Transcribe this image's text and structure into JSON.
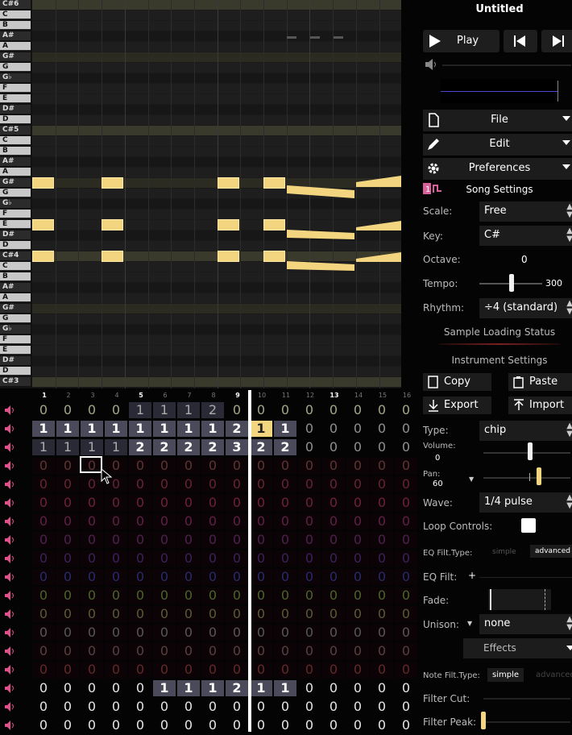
{
  "song": {
    "title": "Untitled"
  },
  "transport": {
    "play_label": "Play"
  },
  "menus": {
    "file": "File",
    "edit": "Edit",
    "preferences": "Preferences"
  },
  "song_settings": {
    "heading": "Song Settings",
    "scale_label": "Scale:",
    "scale_value": "Free",
    "key_label": "Key:",
    "key_value": "C#",
    "octave_label": "Octave:",
    "octave_value": "0",
    "tempo_label": "Tempo:",
    "tempo_value": "300",
    "rhythm_label": "Rhythm:",
    "rhythm_value": "÷4 (standard)",
    "sample_status": "Sample Loading Status"
  },
  "instrument": {
    "heading": "Instrument Settings",
    "copy": "Copy",
    "paste": "Paste",
    "export": "Export",
    "import": "Import",
    "type_label": "Type:",
    "type_value": "chip",
    "volume_label": "Volume:",
    "volume_value": "0",
    "pan_label": "Pan:",
    "pan_value": "60",
    "wave_label": "Wave:",
    "wave_value": "1/4 pulse",
    "loop_label": "Loop Controls:",
    "eq_type_label": "EQ Filt.Type:",
    "eq_simple": "simple",
    "eq_advanced": "advanced",
    "eq_filt_label": "EQ Filt:",
    "eq_add": "+",
    "fade_label": "Fade:",
    "unison_label": "Unison:",
    "unison_value": "none",
    "effects_label": "Effects",
    "note_type_label": "Note Filt.Type:",
    "note_simple": "simple",
    "note_advanced": "advanced",
    "filter_cut_label": "Filter Cut:",
    "filter_peak_label": "Filter Peak:"
  },
  "piano_keys": [
    {
      "label": "C#6",
      "black": true
    },
    {
      "label": "C",
      "black": false
    },
    {
      "label": "B",
      "black": false
    },
    {
      "label": "A#",
      "black": true
    },
    {
      "label": "A",
      "black": false
    },
    {
      "label": "G#",
      "black": true
    },
    {
      "label": "G",
      "black": false
    },
    {
      "label": "G♭",
      "black": true
    },
    {
      "label": "F",
      "black": false
    },
    {
      "label": "E",
      "black": false
    },
    {
      "label": "D#",
      "black": true
    },
    {
      "label": "D",
      "black": false
    },
    {
      "label": "C#5",
      "black": true
    },
    {
      "label": "C",
      "black": false
    },
    {
      "label": "B",
      "black": false
    },
    {
      "label": "A#",
      "black": true
    },
    {
      "label": "A",
      "black": false
    },
    {
      "label": "G#",
      "black": true
    },
    {
      "label": "G",
      "black": false
    },
    {
      "label": "G♭",
      "black": true
    },
    {
      "label": "F",
      "black": false
    },
    {
      "label": "E",
      "black": false
    },
    {
      "label": "D#",
      "black": true
    },
    {
      "label": "D",
      "black": false
    },
    {
      "label": "C#4",
      "black": true
    },
    {
      "label": "C",
      "black": false
    },
    {
      "label": "B",
      "black": false
    },
    {
      "label": "A#",
      "black": true
    },
    {
      "label": "A",
      "black": false
    },
    {
      "label": "G#",
      "black": true
    },
    {
      "label": "G",
      "black": false
    },
    {
      "label": "G♭",
      "black": true
    },
    {
      "label": "F",
      "black": false
    },
    {
      "label": "E",
      "black": false
    },
    {
      "label": "D#",
      "black": true
    },
    {
      "label": "D",
      "black": false
    },
    {
      "label": "C#3",
      "black": true
    }
  ],
  "columns": [
    "1",
    "2",
    "3",
    "4",
    "5",
    "6",
    "7",
    "8",
    "9",
    "10",
    "11",
    "12",
    "13",
    "14",
    "15",
    "16"
  ],
  "channels": [
    {
      "color": "#b8b89a",
      "cells": [
        "0",
        "0",
        "0",
        "0",
        "1",
        "1",
        "1",
        "2",
        "0",
        "0",
        "0",
        "0",
        "0",
        "0",
        "0",
        "0"
      ],
      "dim": [
        0,
        0,
        0,
        0,
        1,
        1,
        1,
        1,
        0,
        0,
        0,
        0,
        0,
        0,
        0,
        0
      ]
    },
    {
      "color": "#ffffff",
      "cells": [
        "1",
        "1",
        "1",
        "1",
        "1",
        "1",
        "1",
        "1",
        "2",
        "1",
        "1",
        "0",
        "0",
        "0",
        "0",
        "0"
      ],
      "dim": [
        2,
        2,
        2,
        2,
        2,
        2,
        2,
        2,
        2,
        3,
        2,
        0,
        0,
        0,
        0,
        0
      ]
    },
    {
      "color": "#ffffff",
      "cells": [
        "1",
        "1",
        "1",
        "1",
        "2",
        "2",
        "2",
        "2",
        "3",
        "2",
        "2",
        "0",
        "0",
        "0",
        "0",
        "0"
      ],
      "dim": [
        1,
        1,
        1,
        1,
        2,
        2,
        2,
        2,
        2,
        2,
        2,
        0,
        0,
        0,
        0,
        0
      ]
    },
    {
      "color": "#ab5a5a",
      "cells": [
        "0",
        "0",
        "0",
        "0",
        "0",
        "0",
        "0",
        "0",
        "0",
        "0",
        "0",
        "0",
        "0",
        "0",
        "0",
        "0"
      ],
      "dim": [
        0,
        0,
        0,
        0,
        0,
        0,
        0,
        0,
        0,
        0,
        0,
        0,
        0,
        0,
        0,
        0
      ]
    },
    {
      "color": "#b0405a",
      "cells": [
        "0",
        "0",
        "0",
        "0",
        "0",
        "0",
        "0",
        "0",
        "0",
        "0",
        "0",
        "0",
        "0",
        "0",
        "0",
        "0"
      ],
      "dim": [
        0,
        0,
        0,
        0,
        0,
        0,
        0,
        0,
        0,
        0,
        0,
        0,
        0,
        0,
        0,
        0
      ]
    },
    {
      "color": "#c03a6a",
      "cells": [
        "0",
        "0",
        "0",
        "0",
        "0",
        "0",
        "0",
        "0",
        "0",
        "0",
        "0",
        "0",
        "0",
        "0",
        "0",
        "0"
      ],
      "dim": [
        0,
        0,
        0,
        0,
        0,
        0,
        0,
        0,
        0,
        0,
        0,
        0,
        0,
        0,
        0,
        0
      ]
    },
    {
      "color": "#a83a7a",
      "cells": [
        "0",
        "0",
        "0",
        "0",
        "0",
        "0",
        "0",
        "0",
        "0",
        "0",
        "0",
        "0",
        "0",
        "0",
        "0",
        "0"
      ],
      "dim": [
        0,
        0,
        0,
        0,
        0,
        0,
        0,
        0,
        0,
        0,
        0,
        0,
        0,
        0,
        0,
        0
      ]
    },
    {
      "color": "#8a3a8a",
      "cells": [
        "0",
        "0",
        "0",
        "0",
        "0",
        "0",
        "0",
        "0",
        "0",
        "0",
        "0",
        "0",
        "0",
        "0",
        "0",
        "0"
      ],
      "dim": [
        0,
        0,
        0,
        0,
        0,
        0,
        0,
        0,
        0,
        0,
        0,
        0,
        0,
        0,
        0,
        0
      ]
    },
    {
      "color": "#6a3aa0",
      "cells": [
        "0",
        "0",
        "0",
        "0",
        "0",
        "0",
        "0",
        "0",
        "0",
        "0",
        "0",
        "0",
        "0",
        "0",
        "0",
        "0"
      ],
      "dim": [
        0,
        0,
        0,
        0,
        0,
        0,
        0,
        0,
        0,
        0,
        0,
        0,
        0,
        0,
        0,
        0
      ]
    },
    {
      "color": "#4a48c0",
      "cells": [
        "0",
        "0",
        "0",
        "0",
        "0",
        "0",
        "0",
        "0",
        "0",
        "0",
        "0",
        "0",
        "0",
        "0",
        "0",
        "0"
      ],
      "dim": [
        0,
        0,
        0,
        0,
        0,
        0,
        0,
        0,
        0,
        0,
        0,
        0,
        0,
        0,
        0,
        0
      ]
    },
    {
      "color": "#8ab04a",
      "cells": [
        "0",
        "0",
        "0",
        "0",
        "0",
        "0",
        "0",
        "0",
        "0",
        "0",
        "0",
        "0",
        "0",
        "0",
        "0",
        "0"
      ],
      "dim": [
        0,
        0,
        0,
        0,
        0,
        0,
        0,
        0,
        0,
        0,
        0,
        0,
        0,
        0,
        0,
        0
      ]
    },
    {
      "color": "#a0a060",
      "cells": [
        "0",
        "0",
        "0",
        "0",
        "0",
        "0",
        "0",
        "0",
        "0",
        "0",
        "0",
        "0",
        "0",
        "0",
        "0",
        "0"
      ],
      "dim": [
        0,
        0,
        0,
        0,
        0,
        0,
        0,
        0,
        0,
        0,
        0,
        0,
        0,
        0,
        0,
        0
      ]
    },
    {
      "color": "#9a9a9a",
      "cells": [
        "0",
        "0",
        "0",
        "0",
        "0",
        "0",
        "0",
        "0",
        "0",
        "0",
        "0",
        "0",
        "0",
        "0",
        "0",
        "0"
      ],
      "dim": [
        0,
        0,
        0,
        0,
        0,
        0,
        0,
        0,
        0,
        0,
        0,
        0,
        0,
        0,
        0,
        0
      ]
    },
    {
      "color": "#a07070",
      "cells": [
        "0",
        "0",
        "0",
        "0",
        "0",
        "0",
        "0",
        "0",
        "0",
        "0",
        "0",
        "0",
        "0",
        "0",
        "0",
        "0"
      ],
      "dim": [
        0,
        0,
        0,
        0,
        0,
        0,
        0,
        0,
        0,
        0,
        0,
        0,
        0,
        0,
        0,
        0
      ]
    },
    {
      "color": "#b04848",
      "cells": [
        "0",
        "0",
        "0",
        "0",
        "0",
        "0",
        "0",
        "0",
        "0",
        "0",
        "0",
        "0",
        "0",
        "0",
        "0",
        "0"
      ],
      "dim": [
        0,
        0,
        0,
        0,
        0,
        0,
        0,
        0,
        0,
        0,
        0,
        0,
        0,
        0,
        0,
        0
      ]
    },
    {
      "color": "#ffffff",
      "cells": [
        "0",
        "0",
        "0",
        "0",
        "0",
        "1",
        "1",
        "1",
        "2",
        "1",
        "1",
        "0",
        "0",
        "0",
        "0",
        "0"
      ],
      "dim": [
        0,
        0,
        0,
        0,
        0,
        2,
        2,
        2,
        2,
        2,
        2,
        0,
        0,
        0,
        0,
        0
      ]
    },
    {
      "color": "#ffffff",
      "cells": [
        "0",
        "0",
        "0",
        "0",
        "0",
        "0",
        "0",
        "0",
        "0",
        "0",
        "0",
        "0",
        "0",
        "0",
        "0",
        "0"
      ],
      "dim": [
        0,
        0,
        0,
        0,
        0,
        0,
        0,
        0,
        0,
        0,
        0,
        0,
        0,
        0,
        0,
        0
      ]
    },
    {
      "color": "#ffffff",
      "cells": [
        "0",
        "0",
        "0",
        "0",
        "0",
        "0",
        "0",
        "0",
        "0",
        "0",
        "0",
        "0",
        "0",
        "0",
        "0",
        "0"
      ],
      "dim": [
        0,
        0,
        0,
        0,
        0,
        0,
        0,
        0,
        0,
        0,
        0,
        0,
        0,
        0,
        0,
        0
      ]
    }
  ]
}
